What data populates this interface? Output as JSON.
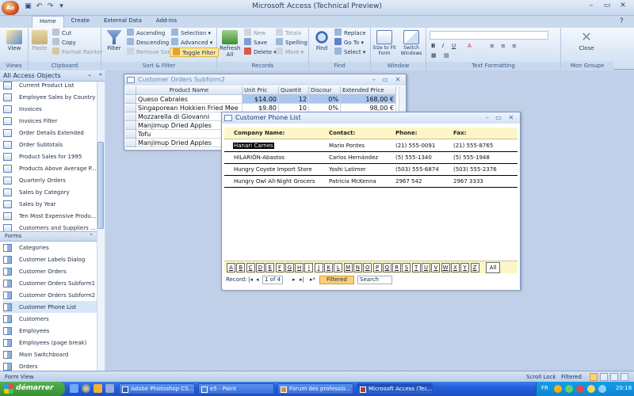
{
  "app": {
    "title": "Microsoft Access (Technical Preview)",
    "office_button": "Ao"
  },
  "tabs": [
    "Home",
    "Create",
    "External Data",
    "Add-Ins"
  ],
  "ribbon": {
    "views": {
      "view_label": "View",
      "group": "Views"
    },
    "clipboard": {
      "paste": "Paste",
      "cut": "Cut",
      "copy": "Copy",
      "format_painter": "Format Painter",
      "group": "Clipboard"
    },
    "sort_filter": {
      "filter": "Filter",
      "ascending": "Ascending",
      "descending": "Descending",
      "remove_sort": "Remove Sort",
      "selection": "Selection",
      "advanced": "Advanced",
      "toggle_filter": "Toggle Filter",
      "group": "Sort & Filter"
    },
    "records": {
      "refresh_all": "Refresh All",
      "new": "New",
      "save": "Save",
      "delete": "Delete",
      "totals": "Totals",
      "spelling": "Spelling",
      "more": "More",
      "group": "Records"
    },
    "find": {
      "find": "Find",
      "replace": "Replace",
      "go_to": "Go To",
      "select": "Select",
      "group": "Find"
    },
    "window": {
      "size_to_fit": "Size to Fit Form",
      "switch_windows": "Switch Windows",
      "group": "Window"
    },
    "text_formatting": {
      "group": "Text Formatting"
    },
    "mon_groupe": {
      "close": "Close",
      "group": "Mon Groupe"
    }
  },
  "nav": {
    "header": "All Access Objects",
    "query_items": [
      "Current Product List",
      "Employee Sales by Country",
      "Invoices",
      "Invoices Filter",
      "Order Details Extended",
      "Order Subtotals",
      "Product Sales for 1995",
      "Products Above Average P...",
      "Quarterly Orders",
      "Sales by Category",
      "Sales by Year",
      "Ten Most Expensive Produ...",
      "Customers and Suppliers ..."
    ],
    "forms_header": "Forms",
    "form_items": [
      "Categories",
      "Customer Labels Dialog",
      "Customer Orders",
      "Customer Orders Subform1",
      "Customer Orders Subform2",
      "Customer Phone List",
      "Customers",
      "Employees",
      "Employees (page break)",
      "Main Switchboard",
      "Orders"
    ],
    "selected": "Customer Phone List"
  },
  "subform": {
    "title": "Customer Orders Subform2",
    "columns": [
      "Product Name",
      "Unit Pric",
      "Quantit",
      "Discour",
      "Extended Price"
    ],
    "rows": [
      [
        "Queso Cabrales",
        "$14.00",
        "12",
        "0%",
        "168,00 €"
      ],
      [
        "Singaporean Hokkien Fried Mee",
        "$9.80",
        "10",
        "0%",
        "98,00 €"
      ],
      [
        "Mozzarella di Giovanni",
        "",
        "",
        "",
        ""
      ],
      [
        "Manjimup Dried Apples",
        "",
        "",
        "",
        ""
      ],
      [
        "Tofu",
        "",
        "",
        "",
        ""
      ],
      [
        "Manjimup Dried Apples",
        "",
        "",
        "",
        ""
      ]
    ]
  },
  "phone_list": {
    "title": "Customer Phone List",
    "headers": {
      "company": "Company Name:",
      "contact": "Contact:",
      "phone": "Phone:",
      "fax": "Fax:"
    },
    "rows": [
      {
        "company": "Hanari Carnes",
        "contact": "Mario Pontes",
        "phone": "(21) 555-0091",
        "fax": "(21) 555-8765"
      },
      {
        "company": "HILARIÓN-Abastos",
        "contact": "Carlos Hernández",
        "phone": "(5) 555-1340",
        "fax": "(5) 555-1948"
      },
      {
        "company": "Hungry Coyote Import Store",
        "contact": "Yoshi Latimer",
        "phone": "(503) 555-6874",
        "fax": "(503) 555-2376"
      },
      {
        "company": "Hungry Owl All-Night Grocers",
        "contact": "Patricia McKenna",
        "phone": "2967 542",
        "fax": "2967 3333"
      }
    ],
    "letters": [
      "A",
      "B",
      "C",
      "D",
      "E",
      "F",
      "G",
      "H",
      "I",
      "J",
      "K",
      "L",
      "M",
      "N",
      "O",
      "P",
      "Q",
      "R",
      "S",
      "T",
      "U",
      "V",
      "W",
      "X",
      "Y",
      "Z"
    ],
    "all_label": "All",
    "record_label": "Record:",
    "record_value": "1 of 4",
    "filtered_label": "Filtered",
    "search_label": "Search"
  },
  "status": {
    "left": "Form View",
    "scroll_lock": "Scroll Lock",
    "filtered": "Filtered"
  },
  "taskbar": {
    "start": "démarrer",
    "buttons": [
      "Adobe Photoshop CS...",
      "e5 - Paint",
      "Forum des professio...",
      "Microsoft Access (Tec..."
    ],
    "lang": "FR",
    "clock": "20:18"
  }
}
